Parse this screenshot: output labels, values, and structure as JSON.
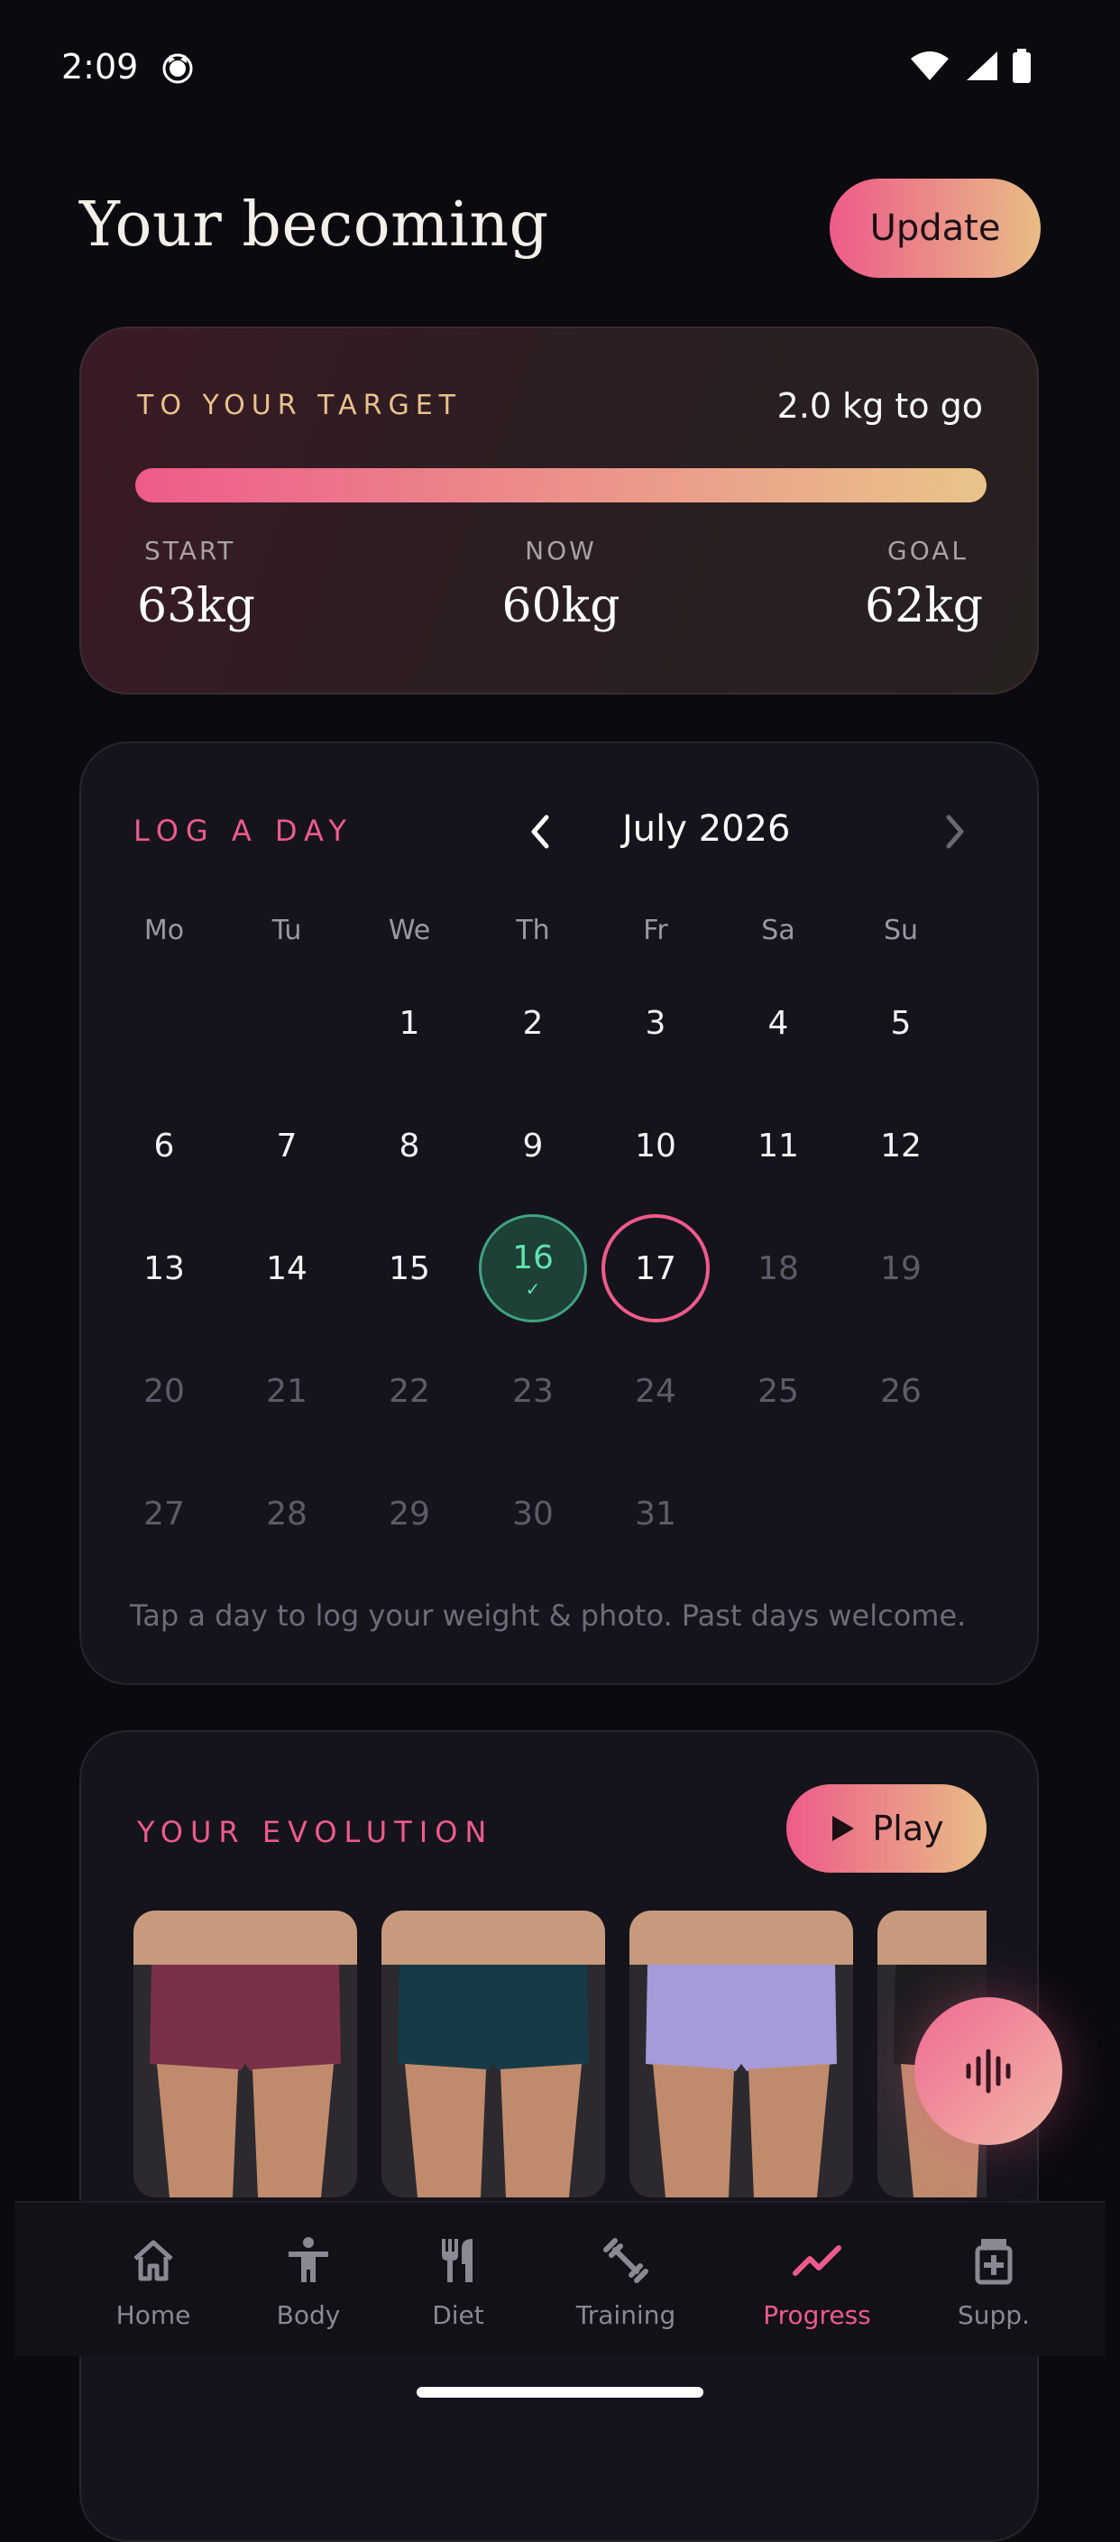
{
  "status": {
    "time": "2:09"
  },
  "header": {
    "title": "Your becoming",
    "update_label": "Update"
  },
  "target": {
    "label": "TO YOUR TARGET",
    "to_go": "2.0 kg to go",
    "progress_fraction": 1.0,
    "start_label": "START",
    "start_value": "63kg",
    "now_label": "NOW",
    "now_value": "60kg",
    "goal_label": "GOAL",
    "goal_value": "62kg"
  },
  "calendar": {
    "label": "LOG A DAY",
    "month": "July 2026",
    "weekdays": [
      "Mo",
      "Tu",
      "We",
      "Th",
      "Fr",
      "Sa",
      "Su"
    ],
    "first_weekday_index": 2,
    "days_in_month": 31,
    "logged_day": 16,
    "today": 17,
    "hint": "Tap a day to log your weight & photo. Past days welcome."
  },
  "evolution": {
    "label": "YOUR EVOLUTION",
    "play_label": "Play",
    "photos": [
      {
        "name": "photo-maroon-shorts",
        "color": "#7a3048"
      },
      {
        "name": "photo-teal-leggings",
        "color": "#163b46"
      },
      {
        "name": "photo-lavender-shorts",
        "color": "#a69bd8"
      },
      {
        "name": "photo-black-leggings",
        "color": "#1c1c1f"
      }
    ]
  },
  "nav": {
    "items": [
      {
        "label": "Home",
        "icon": "home-icon"
      },
      {
        "label": "Body",
        "icon": "body-icon"
      },
      {
        "label": "Diet",
        "icon": "diet-icon"
      },
      {
        "label": "Training",
        "icon": "training-icon"
      },
      {
        "label": "Progress",
        "icon": "progress-icon",
        "selected": true
      },
      {
        "label": "Supp.",
        "icon": "supplements-icon"
      }
    ]
  },
  "colors": {
    "accent": "#ee5b8a",
    "gold": "#e9c28c",
    "success": "#3fa37f"
  }
}
